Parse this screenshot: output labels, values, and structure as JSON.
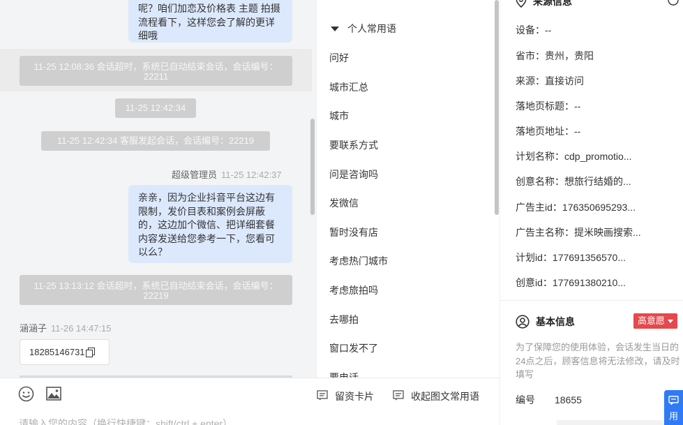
{
  "chat": {
    "bubble_top_text": "呢？咱们加恋及价格表 主题 拍摄流程看下，这样您会了解的更详细哦",
    "sys_timeout_1": "11-25 12:08:36 会话超时，系统已自动结束会话，会话编号：22211",
    "time_divider": "11-25 12:42:34",
    "sys_agent_start": "11-25 12:42:34 客服发起会话，会话编号：22219",
    "agent_name": "超级管理员",
    "agent_time": "11-25 12:42:37",
    "bubble_main_text": "亲亲，因为企业抖音平台这边有限制，发价目表和案例会屏蔽的，这边加个微信、把详细套餐内容发送给您参考一下，您看可以么？",
    "sys_timeout_2": "11-25 13:13:12 会话超时，系统已自动结束会话，会话编号：22219",
    "customer_name": "涵涵子",
    "customer_time": "11-26 14:47:15",
    "phone": "18285146731"
  },
  "input": {
    "emoji_icon": "smile-icon",
    "image_icon": "image-icon",
    "leave_card_label": "留资卡片",
    "collapse_label": "收起图文常用语",
    "placeholder": "请输入您的内容（换行快捷键：shift/ctrl + enter）"
  },
  "phrases": {
    "group_label": "个人常用语",
    "items": [
      "问好",
      "城市汇总",
      "城市",
      "要联系方式",
      "问是咨询吗",
      "发微信",
      "暂时没有店",
      "考虑热门城市",
      "考虑旅拍吗",
      "去哪拍",
      "窗口发不了",
      "要电话"
    ]
  },
  "info": {
    "source_title": "来源信息",
    "source_rows": [
      {
        "label": "设备：",
        "value": "--"
      },
      {
        "label": "省市：",
        "value": "贵州，贵阳"
      },
      {
        "label": "来源：",
        "value": "直接访问"
      },
      {
        "label": "落地页标题：",
        "value": "--"
      },
      {
        "label": "落地页地址：",
        "value": "--"
      },
      {
        "label": "计划名称：",
        "value": "cdp_promotio..."
      },
      {
        "label": "创意名称：",
        "value": "想旅行结婚的..."
      },
      {
        "label": "广告主id：",
        "value": "176350695293..."
      },
      {
        "label": "广告主名称：",
        "value": "提米映画搜索..."
      },
      {
        "label": "计划id：",
        "value": "177691356570..."
      },
      {
        "label": "创意id：",
        "value": "177691380210..."
      }
    ],
    "basic_title": "基本信息",
    "intent_tag": "高意愿",
    "notice": "为了保障您的使用体验，会话发生当日的24点之后，顾客信息将无法修改，请及时填写",
    "number_label": "编号",
    "number_value": "18655",
    "float_label": "用"
  },
  "colors": {
    "bubble": "#dce9fd",
    "system": "#cfcfcf",
    "tag": "#e5484d",
    "float_button": "#2f7bf5"
  }
}
